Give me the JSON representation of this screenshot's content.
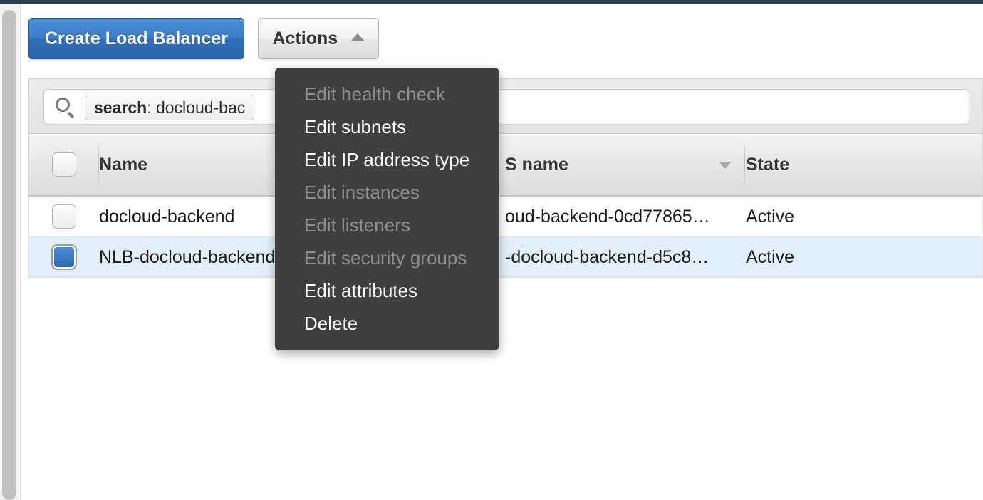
{
  "toolbar": {
    "create_label": "Create Load Balancer",
    "actions_label": "Actions",
    "actions_caret": "caret-up-icon"
  },
  "search": {
    "icon": "search-icon",
    "token_key": "search",
    "token_separator": ":",
    "token_value": "docloud-bac"
  },
  "table": {
    "columns": [
      {
        "id": "checkbox",
        "label": ""
      },
      {
        "id": "name",
        "label": "Name"
      },
      {
        "id": "dns_name",
        "label": "S name",
        "sorted": true
      },
      {
        "id": "state",
        "label": "State"
      }
    ],
    "rows": [
      {
        "selected": false,
        "name": "docloud-backend",
        "dns_name": "oud-backend-0cd77865…",
        "state": "Active"
      },
      {
        "selected": true,
        "name": "NLB-docloud-backend",
        "dns_name": "-docloud-backend-d5c8…",
        "state": "Active"
      }
    ]
  },
  "actions_menu": {
    "items": [
      {
        "label": "Edit health check",
        "disabled": true
      },
      {
        "label": "Edit subnets",
        "disabled": false
      },
      {
        "label": "Edit IP address type",
        "disabled": false
      },
      {
        "label": "Edit instances",
        "disabled": true
      },
      {
        "label": "Edit listeners",
        "disabled": true
      },
      {
        "label": "Edit security groups",
        "disabled": true
      },
      {
        "label": "Edit attributes",
        "disabled": false
      },
      {
        "label": "Delete",
        "disabled": false
      }
    ]
  },
  "colors": {
    "topbar": "#2f3e4e",
    "primary_button": "#2f6fbb",
    "menu_background": "#3f3f3f",
    "selected_row": "#e3eefb",
    "disabled_text": "#8e8e8e"
  }
}
